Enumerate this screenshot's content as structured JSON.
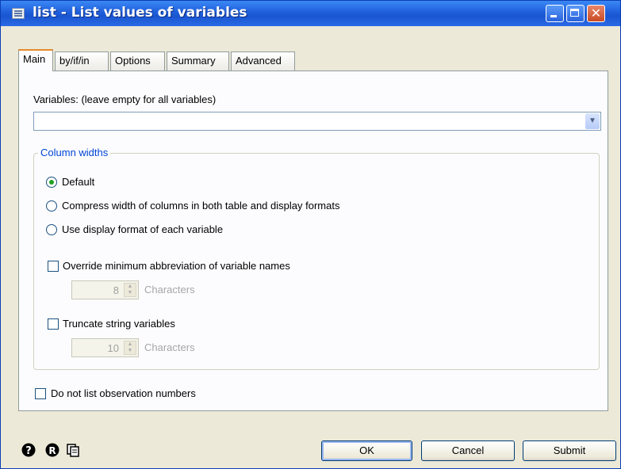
{
  "window": {
    "title": "list - List values of variables"
  },
  "tabs": [
    {
      "label": "Main"
    },
    {
      "label": "by/if/in"
    },
    {
      "label": "Options"
    },
    {
      "label": "Summary"
    },
    {
      "label": "Advanced"
    }
  ],
  "main": {
    "variables_label": "Variables: (leave empty for all variables)",
    "variables_value": "",
    "column_widths": {
      "title": "Column widths",
      "radio_options": [
        {
          "label": "Default",
          "selected": true
        },
        {
          "label": "Compress width of columns in both table and display formats",
          "selected": false
        },
        {
          "label": "Use display format of each variable",
          "selected": false
        }
      ],
      "override_abbrev": {
        "label": "Override minimum abbreviation of variable names",
        "checked": false,
        "value": "8",
        "unit": "Characters"
      },
      "truncate_strings": {
        "label": "Truncate string variables",
        "checked": false,
        "value": "10",
        "unit": "Characters"
      }
    },
    "no_obs_numbers": {
      "label": "Do not list observation numbers",
      "checked": false
    }
  },
  "footer": {
    "icons": [
      "help-icon",
      "reset-icon",
      "copy-command-icon"
    ],
    "ok_label": "OK",
    "cancel_label": "Cancel",
    "submit_label": "Submit"
  }
}
